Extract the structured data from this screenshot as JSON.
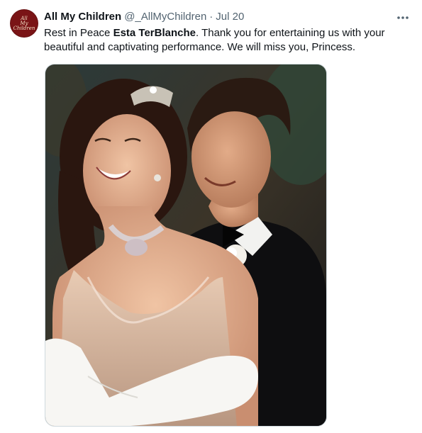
{
  "tweet": {
    "author_name": "All My Children",
    "handle": "@_AllMyChildren",
    "separator": "·",
    "timestamp": "Jul 20",
    "avatar_text": "All\nMy\nChildren",
    "text_before": "Rest in Peace ",
    "text_bold": "Esta TerBlanche",
    "text_after": ". Thank you for entertaining us with your beautiful and captivating performance. We will miss you, Princess.",
    "more_icon": "more-horizontal-icon",
    "media_alt": "Photo of a smiling couple: a woman in a tiara, necklace and white gloves, and a man in a tuxedo"
  },
  "colors": {
    "text": "#0f1419",
    "secondary": "#536471",
    "avatar_bg": "#7a1416",
    "border": "#cfd9de"
  }
}
